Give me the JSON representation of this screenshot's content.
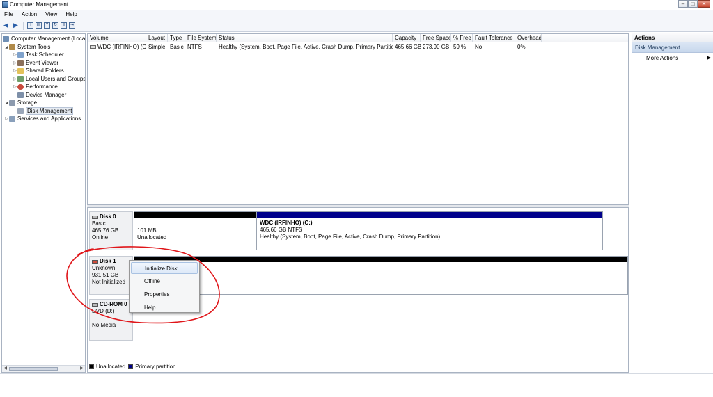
{
  "window": {
    "title": "Computer Management",
    "controls": {
      "minimize": "–",
      "maximize": "□",
      "close": "✕"
    }
  },
  "menubar": [
    "File",
    "Action",
    "View",
    "Help"
  ],
  "toolbar": {
    "icons": [
      "back-arrow-icon",
      "forward-arrow-icon",
      "up-folder-icon",
      "show-hide-tree-icon",
      "help-icon",
      "refresh-icon",
      "properties-icon",
      "export-icon"
    ]
  },
  "tree": {
    "root": "Computer Management (Local",
    "system_tools": "System Tools",
    "task_scheduler": "Task Scheduler",
    "event_viewer": "Event Viewer",
    "shared_folders": "Shared Folders",
    "local_users": "Local Users and Groups",
    "performance": "Performance",
    "device_manager": "Device Manager",
    "storage": "Storage",
    "disk_management": "Disk Management",
    "services": "Services and Applications"
  },
  "volumes": {
    "columns": [
      "Volume",
      "Layout",
      "Type",
      "File System",
      "Status",
      "Capacity",
      "Free Space",
      "% Free",
      "Fault Tolerance",
      "Overhead"
    ],
    "rows": [
      {
        "volume": "WDC (IRFINHO) (C:)",
        "layout": "Simple",
        "type": "Basic",
        "fs": "NTFS",
        "status": "Healthy (System, Boot, Page File, Active, Crash Dump, Primary Partition)",
        "capacity": "465,66 GB",
        "free": "273,90 GB",
        "pct_free": "59 %",
        "fault": "No",
        "overhead": "0%"
      }
    ]
  },
  "disks": {
    "disk0": {
      "name": "Disk 0",
      "type": "Basic",
      "size": "465,76 GB",
      "state": "Online",
      "unalloc": {
        "size": "101 MB",
        "label": "Unallocated"
      },
      "primary": {
        "name": "WDC (IRFINHO)  (C:)",
        "size": "465,66 GB NTFS",
        "status": "Healthy (System, Boot, Page File, Active, Crash Dump, Primary Partition)"
      }
    },
    "disk1": {
      "name": "Disk 1",
      "type": "Unknown",
      "size": "931,51 GB",
      "state": "Not Initialized"
    },
    "cdrom0": {
      "name": "CD-ROM 0",
      "type": "DVD (D:)",
      "state": "No Media"
    }
  },
  "legend": {
    "unallocated": "Unallocated",
    "primary": "Primary partition"
  },
  "colors": {
    "unallocated": "#000000",
    "primary": "#00008b",
    "annotation": "#e0161a"
  },
  "actions": {
    "header": "Actions",
    "section": "Disk Management",
    "more": "More Actions"
  },
  "context_menu": [
    "Initialize Disk",
    "Offline",
    "Properties",
    "Help"
  ]
}
